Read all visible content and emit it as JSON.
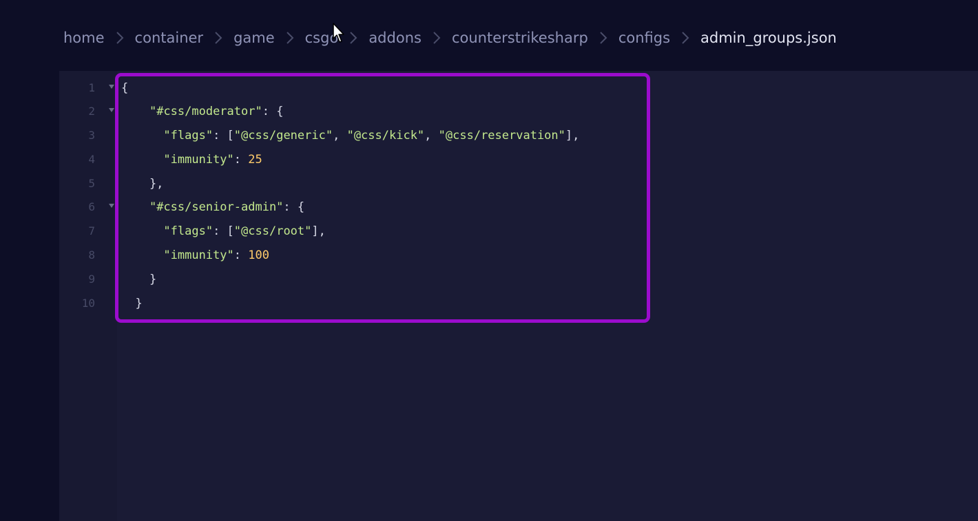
{
  "breadcrumb": {
    "items": [
      "home",
      "container",
      "game",
      "csgo",
      "addons",
      "counterstrikesharp",
      "configs",
      "admin_groups.json"
    ]
  },
  "editor": {
    "line_numbers": [
      "1",
      "2",
      "3",
      "4",
      "5",
      "6",
      "7",
      "8",
      "9",
      "10"
    ],
    "lines": [
      [
        {
          "t": "p",
          "v": "{"
        }
      ],
      [
        {
          "t": "p",
          "v": "    "
        },
        {
          "t": "k",
          "v": "\"#css/moderator\""
        },
        {
          "t": "p",
          "v": ": {"
        }
      ],
      [
        {
          "t": "p",
          "v": "      "
        },
        {
          "t": "k",
          "v": "\"flags\""
        },
        {
          "t": "p",
          "v": ": ["
        },
        {
          "t": "k",
          "v": "\"@css/generic\""
        },
        {
          "t": "p",
          "v": ", "
        },
        {
          "t": "k",
          "v": "\"@css/kick\""
        },
        {
          "t": "p",
          "v": ", "
        },
        {
          "t": "k",
          "v": "\"@css/reservation\""
        },
        {
          "t": "p",
          "v": "],"
        }
      ],
      [
        {
          "t": "p",
          "v": "      "
        },
        {
          "t": "k",
          "v": "\"immunity\""
        },
        {
          "t": "p",
          "v": ": "
        },
        {
          "t": "n",
          "v": "25"
        }
      ],
      [
        {
          "t": "p",
          "v": "    },"
        }
      ],
      [
        {
          "t": "p",
          "v": "    "
        },
        {
          "t": "k",
          "v": "\"#css/senior-admin\""
        },
        {
          "t": "p",
          "v": ": {"
        }
      ],
      [
        {
          "t": "p",
          "v": "      "
        },
        {
          "t": "k",
          "v": "\"flags\""
        },
        {
          "t": "p",
          "v": ": ["
        },
        {
          "t": "k",
          "v": "\"@css/root\""
        },
        {
          "t": "p",
          "v": "],"
        }
      ],
      [
        {
          "t": "p",
          "v": "      "
        },
        {
          "t": "k",
          "v": "\"immunity\""
        },
        {
          "t": "p",
          "v": ": "
        },
        {
          "t": "n",
          "v": "100"
        }
      ],
      [
        {
          "t": "p",
          "v": "    }"
        }
      ],
      [
        {
          "t": "p",
          "v": "  }"
        }
      ]
    ],
    "foldable_lines": [
      1,
      2,
      6
    ]
  },
  "colors": {
    "background": "#0d0e26",
    "editor_bg": "#1a1b35",
    "string": "#c3e88d",
    "number": "#ffcb6b",
    "highlight_border": "#9b0ccd"
  },
  "icons": {
    "separator": "chevron-right-icon",
    "fold": "caret-down-icon",
    "pointer": "mouse-cursor-icon"
  }
}
